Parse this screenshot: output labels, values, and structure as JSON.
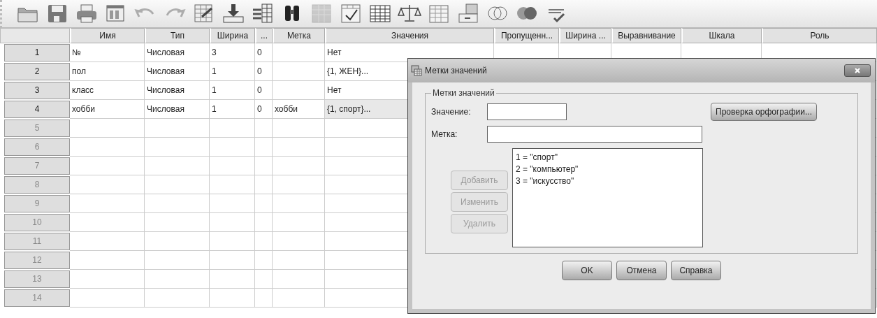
{
  "toolbar": [
    {
      "kind": "folder",
      "disabled": false
    },
    {
      "kind": "save",
      "disabled": false
    },
    {
      "kind": "print",
      "disabled": false
    },
    {
      "kind": "dialog",
      "disabled": false
    },
    {
      "kind": "undo",
      "disabled": true
    },
    {
      "kind": "redo",
      "disabled": true
    },
    {
      "kind": "goto-case",
      "disabled": false
    },
    {
      "kind": "insert-case",
      "disabled": false
    },
    {
      "kind": "goto-var",
      "disabled": false
    },
    {
      "kind": "find",
      "disabled": false
    },
    {
      "kind": "grid",
      "disabled": true
    },
    {
      "kind": "chart",
      "disabled": false
    },
    {
      "kind": "split",
      "disabled": false
    },
    {
      "kind": "weight",
      "disabled": false
    },
    {
      "kind": "select",
      "disabled": false
    },
    {
      "kind": "labels",
      "disabled": false
    },
    {
      "kind": "sets",
      "disabled": false
    },
    {
      "kind": "circles",
      "disabled": false
    },
    {
      "kind": "spell",
      "disabled": false
    }
  ],
  "table": {
    "columns": [
      "Имя",
      "Тип",
      "Ширина",
      "...",
      "Метка",
      "Значения",
      "Пропущенн...",
      "Ширина ...",
      "Выравнивание",
      "Шкала",
      "Роль"
    ],
    "rows": [
      {
        "number": "1",
        "selected": false,
        "cells": [
          "№",
          "Числовая",
          "3",
          "0",
          "",
          "Нет"
        ]
      },
      {
        "number": "2",
        "selected": false,
        "cells": [
          "пол",
          "Числовая",
          "1",
          "0",
          "",
          "{1, ЖЕН}..."
        ]
      },
      {
        "number": "3",
        "selected": false,
        "cells": [
          "класс",
          "Числовая",
          "1",
          "0",
          "",
          "Нет"
        ]
      },
      {
        "number": "4",
        "selected": true,
        "cells": [
          "хобби",
          "Числовая",
          "1",
          "0",
          "хобби",
          "{1, спорт}..."
        ]
      },
      {
        "number": "5",
        "selected": false,
        "cells": []
      },
      {
        "number": "6",
        "selected": false,
        "cells": []
      },
      {
        "number": "7",
        "selected": false,
        "cells": []
      },
      {
        "number": "8",
        "selected": false,
        "cells": []
      },
      {
        "number": "9",
        "selected": false,
        "cells": []
      },
      {
        "number": "10",
        "selected": false,
        "cells": []
      },
      {
        "number": "11",
        "selected": false,
        "cells": []
      },
      {
        "number": "12",
        "selected": false,
        "cells": []
      },
      {
        "number": "13",
        "selected": false,
        "cells": []
      },
      {
        "number": "14",
        "selected": false,
        "cells": []
      }
    ]
  },
  "dialog": {
    "title": "Метки значений",
    "group_title": "Метки значений",
    "value_label": "Значение:",
    "label_label": "Метка:",
    "list": [
      "1 = \"спорт\"",
      "2 = \"компьютер\"",
      "3 = \"искусство\""
    ],
    "side_buttons": [
      {
        "label": "Добавить",
        "disabled": true
      },
      {
        "label": "Изменить",
        "disabled": true
      },
      {
        "label": "Удалить",
        "disabled": true
      }
    ],
    "spell_button": "Проверка орфографии...",
    "buttons": [
      "OK",
      "Отмена",
      "Справка"
    ]
  }
}
